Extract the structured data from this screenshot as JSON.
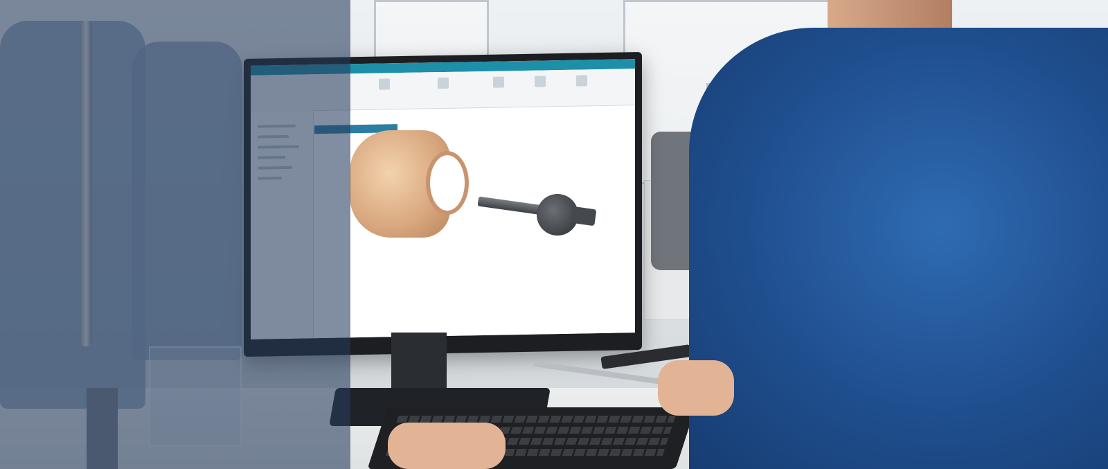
{
  "scene": {
    "description_ok": false,
    "colors": {
      "overlay": "#263a5c",
      "ribbon": "#1e8fa8",
      "shirt": "#2f6bb2",
      "part": "#d8a77e",
      "tool": "#3d4146"
    },
    "icons": [
      "cad-part-icon",
      "tool-holder-icon"
    ]
  }
}
